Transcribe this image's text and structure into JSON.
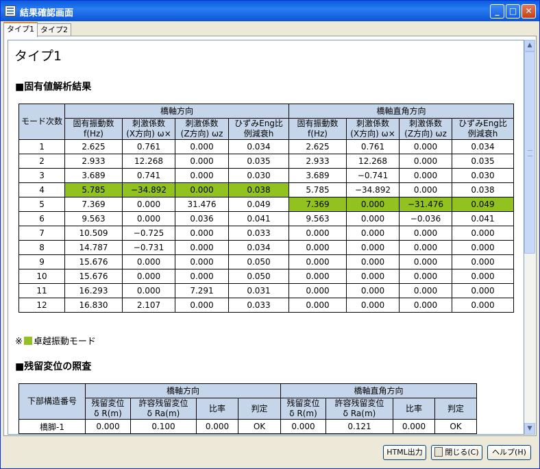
{
  "window": {
    "title": "結果確認画面"
  },
  "tabs": [
    "タイプ1",
    "タイプ2"
  ],
  "doc": {
    "heading": "タイプ1",
    "section1": "■固有値解析結果",
    "section2": "■残留変位の照査",
    "note_prefix": "※",
    "note_text": "卓越振動モード",
    "highlight_color": "#91c21f",
    "header_color": "#c6d6ea"
  },
  "modal_table": {
    "mode_header": "モード次数",
    "group1": "橋軸方向",
    "group2": "橋軸直角方向",
    "col_headers": [
      {
        "l1": "固有振動数",
        "l2": "f(Hz)"
      },
      {
        "l1": "刺激係数",
        "l2": "(X方向) ω×"
      },
      {
        "l1": "刺激係数",
        "l2": "(Z方向) ωz"
      },
      {
        "l1": "ひずみEng比",
        "l2": "例減衰h"
      }
    ],
    "rows": [
      {
        "mode": "1",
        "a": [
          "2.625",
          "0.761",
          "0.000",
          "0.034"
        ],
        "b": [
          "2.625",
          "0.761",
          "0.000",
          "0.034"
        ]
      },
      {
        "mode": "2",
        "a": [
          "2.933",
          "12.268",
          "0.000",
          "0.035"
        ],
        "b": [
          "2.933",
          "12.268",
          "0.000",
          "0.035"
        ]
      },
      {
        "mode": "3",
        "a": [
          "3.689",
          "0.741",
          "0.000",
          "0.030"
        ],
        "b": [
          "3.689",
          "−0.741",
          "0.000",
          "0.030"
        ]
      },
      {
        "mode": "4",
        "a": [
          "5.785",
          "−34.892",
          "0.000",
          "0.038"
        ],
        "b": [
          "5.785",
          "−34.892",
          "0.000",
          "0.038"
        ],
        "hl": "a"
      },
      {
        "mode": "5",
        "a": [
          "7.369",
          "0.000",
          "31.476",
          "0.049"
        ],
        "b": [
          "7.369",
          "0.000",
          "−31.476",
          "0.049"
        ],
        "hl": "b"
      },
      {
        "mode": "6",
        "a": [
          "9.563",
          "0.000",
          "0.036",
          "0.041"
        ],
        "b": [
          "9.563",
          "0.000",
          "−0.036",
          "0.041"
        ]
      },
      {
        "mode": "7",
        "a": [
          "10.509",
          "−0.725",
          "0.000",
          "0.033"
        ],
        "b": [
          "0.000",
          "0.000",
          "0.000",
          "0.000"
        ]
      },
      {
        "mode": "8",
        "a": [
          "14.787",
          "−0.731",
          "0.000",
          "0.034"
        ],
        "b": [
          "0.000",
          "0.000",
          "0.000",
          "0.000"
        ]
      },
      {
        "mode": "9",
        "a": [
          "15.676",
          "0.000",
          "0.000",
          "0.050"
        ],
        "b": [
          "0.000",
          "0.000",
          "0.000",
          "0.000"
        ]
      },
      {
        "mode": "10",
        "a": [
          "15.676",
          "0.000",
          "0.000",
          "0.050"
        ],
        "b": [
          "0.000",
          "0.000",
          "0.000",
          "0.000"
        ]
      },
      {
        "mode": "11",
        "a": [
          "16.293",
          "0.000",
          "7.291",
          "0.031"
        ],
        "b": [
          "0.000",
          "0.000",
          "0.000",
          "0.000"
        ]
      },
      {
        "mode": "12",
        "a": [
          "16.830",
          "2.107",
          "0.000",
          "0.033"
        ],
        "b": [
          "0.000",
          "0.000",
          "0.000",
          "0.000"
        ]
      }
    ]
  },
  "residual_table": {
    "pier_header": "下部構造番号",
    "group1": "橋軸方向",
    "group2": "橋軸直角方向",
    "col_headers": [
      {
        "l1": "残留変位",
        "l2": "δ R(m)"
      },
      {
        "l1": "許容残留変位",
        "l2": "δ Ra(m)"
      },
      {
        "l1": "比率",
        "l2": ""
      },
      {
        "l1": "判定",
        "l2": ""
      }
    ],
    "rows": [
      {
        "pier": "橋脚-1",
        "a": [
          "0.000",
          "0.100",
          "0.000",
          "OK"
        ],
        "b": [
          "0.000",
          "0.121",
          "0.000",
          "OK"
        ]
      }
    ]
  },
  "buttons": {
    "html_output": "HTML出力",
    "close": "閉じる(C)",
    "help": "ヘルプ(H)"
  }
}
